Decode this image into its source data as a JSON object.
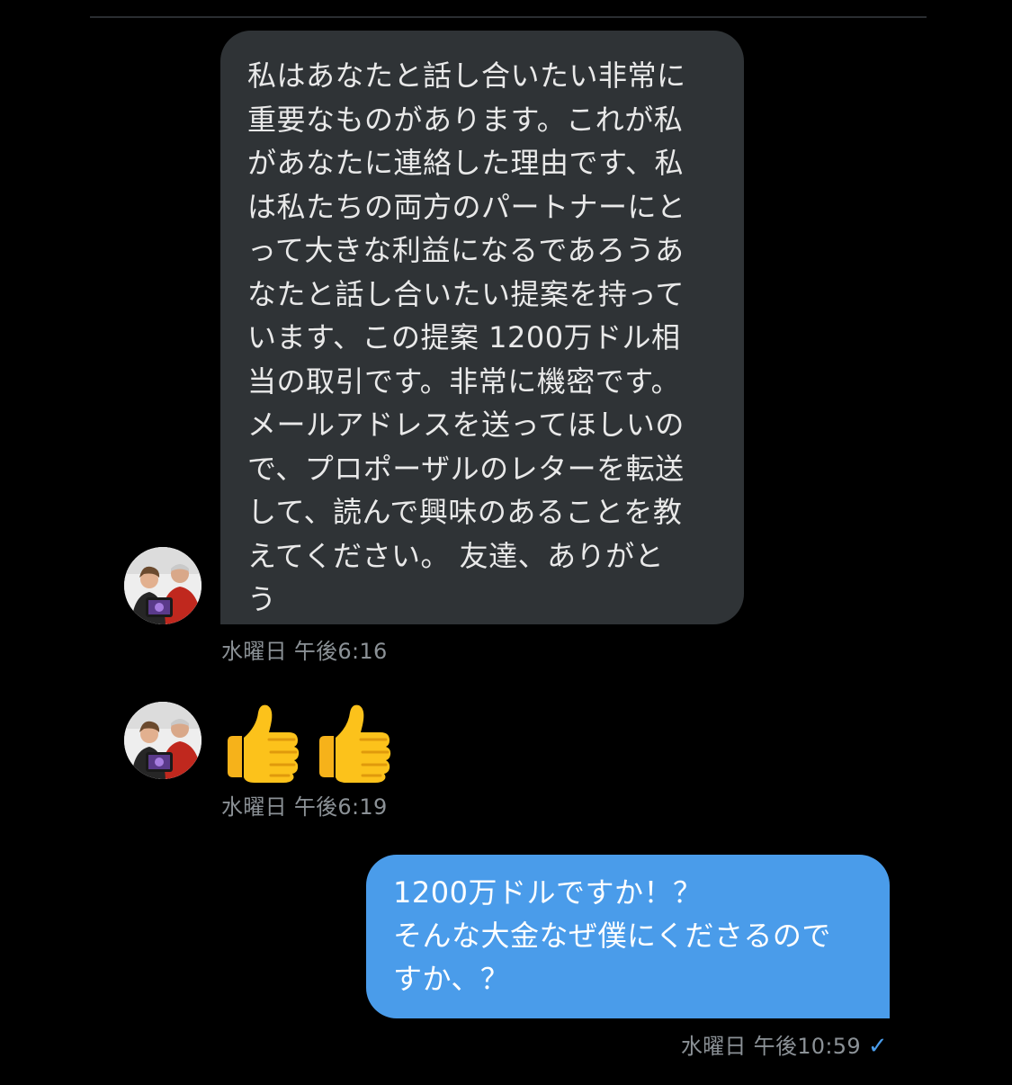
{
  "messages": [
    {
      "direction": "incoming",
      "text": "私はあなたと話し合いたい非常に\n重要なものがあります。これが私\nがあなたに連絡した理由です、私\nは私たちの両方のパートナーにと\nって大きな利益になるであろうあ\nなたと話し合いたい提案を持って\nいます、この提案 1200万ドル相\n当の取引です。非常に機密です。\nメールアドレスを送ってほしいの\nで、プロポーザルのレターを転送\nして、読んで興味のあることを教\nえてください。 友達、ありがと\nう",
      "timestamp": "水曜日 午後6:16"
    },
    {
      "direction": "incoming",
      "emoji": "👍👍",
      "timestamp": "水曜日 午後6:19"
    },
    {
      "direction": "outgoing",
      "text": "1200万ドルですか！？\nそんな大金なぜ僕にくださるので\nすか、？",
      "timestamp": "水曜日 午後10:59",
      "status_icon": "✓"
    }
  ],
  "colors": {
    "background": "#000000",
    "incoming_bubble": "#2f3336",
    "outgoing_bubble": "#4a9cea",
    "timestamp": "#8b9196"
  },
  "icons": {
    "avatar": "profile-photo-avatar",
    "thumbs_up": "thumbs-up-emoji",
    "read_check": "checkmark-icon"
  }
}
